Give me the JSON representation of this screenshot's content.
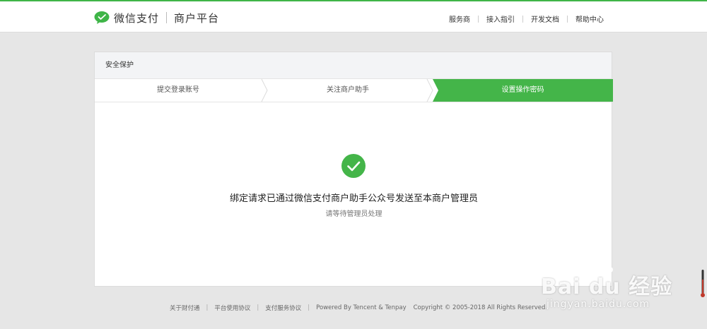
{
  "header": {
    "brand": "微信支付",
    "sub_brand": "商户平台",
    "nav": [
      "服务商",
      "接入指引",
      "开发文档",
      "帮助中心"
    ]
  },
  "panel": {
    "title": "安全保护",
    "steps": [
      "提交登录账号",
      "关注商户助手",
      "设置操作密码"
    ],
    "active_step": 3
  },
  "result": {
    "message": "绑定请求已通过微信支付商户助手公众号发送至本商户管理员",
    "sub_message": "请等待管理员处理"
  },
  "footer": {
    "links": [
      "关于财付通",
      "平台使用协议",
      "支付服务协议",
      "Powered By Tencent & Tenpay"
    ],
    "copyright": "Copyright © 2005-2018 All Rights Reserved."
  },
  "watermark": {
    "text": "Bai du 经验",
    "url": "jingyan.baidu.com"
  },
  "colors": {
    "accent": "#44b549",
    "page_bg": "#e6e6e6"
  }
}
